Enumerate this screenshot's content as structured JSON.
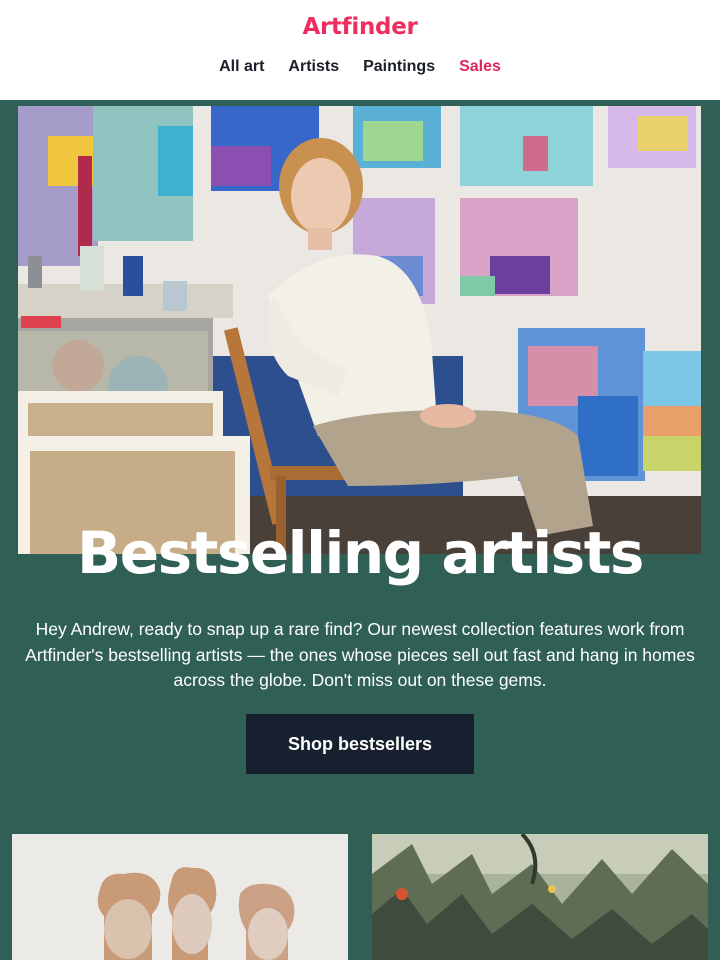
{
  "brand": {
    "logo_text": "Artfinder",
    "accent_color": "#ef2d5e"
  },
  "nav": {
    "items": [
      {
        "label": "All art"
      },
      {
        "label": "Artists"
      },
      {
        "label": "Paintings"
      },
      {
        "label": "Sales"
      }
    ]
  },
  "hero": {
    "title": "Bestselling artists",
    "body": "Hey Andrew, ready to snap up a rare find? Our newest collection features work from Artfinder's bestselling artists — the ones whose pieces sell out fast and hang in homes across the globe. Don't miss out on these gems.",
    "cta_label": "Shop bestsellers",
    "background_color": "#2f5f55",
    "cta_color": "#17202e"
  }
}
